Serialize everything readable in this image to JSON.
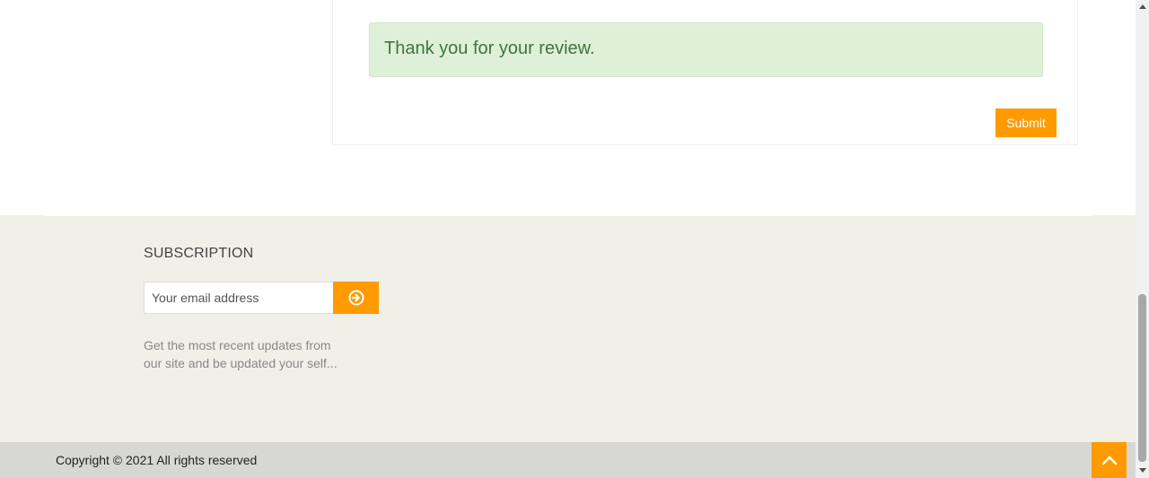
{
  "review": {
    "success_message": "Thank you for your review.",
    "submit_label": "Submit"
  },
  "subscription": {
    "title": "SUBSCRIPTION",
    "email_placeholder": "Your email address",
    "description": "Get the most recent updates from our site and be updated your self..."
  },
  "footer": {
    "copyright": "Copyright © 2021 All rights reserved"
  },
  "icons": {
    "subscribe": "arrow-circle-right-icon",
    "back_to_top": "chevron-up-icon"
  },
  "colors": {
    "accent": "#ff9a00",
    "success_bg": "#dff0d8",
    "success_text": "#3c763d",
    "footer_bg": "#f0efe8",
    "copyright_bg": "#d8d8d2"
  }
}
